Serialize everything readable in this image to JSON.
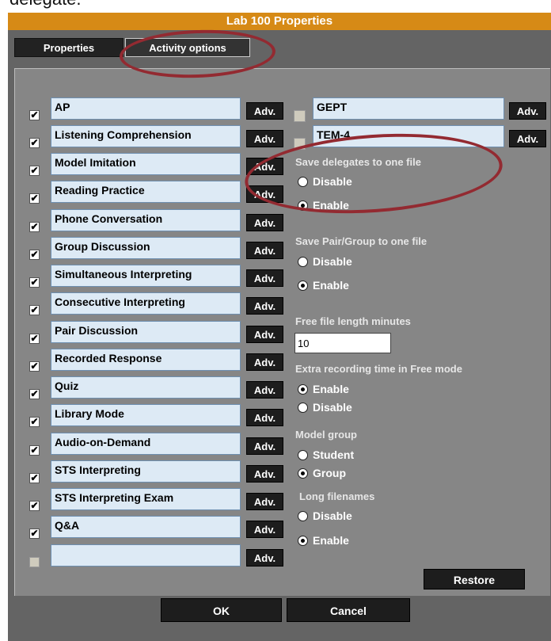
{
  "cropped_caption": "delegate.",
  "window": {
    "title": "Lab 100 Properties"
  },
  "tabs": [
    "Properties",
    "Activity options"
  ],
  "activities_left": [
    {
      "label": "AP",
      "checked": true
    },
    {
      "label": "Listening Comprehension",
      "checked": true
    },
    {
      "label": "Model Imitation",
      "checked": true
    },
    {
      "label": "Reading Practice",
      "checked": true
    },
    {
      "label": "Phone Conversation",
      "checked": true
    },
    {
      "label": "Group Discussion",
      "checked": true
    },
    {
      "label": "Simultaneous Interpreting",
      "checked": true
    },
    {
      "label": "Consecutive Interpreting",
      "checked": true
    },
    {
      "label": "Pair Discussion",
      "checked": true
    },
    {
      "label": "Recorded Response",
      "checked": true
    },
    {
      "label": "Quiz",
      "checked": true
    },
    {
      "label": "Library Mode",
      "checked": true
    },
    {
      "label": "Audio-on-Demand",
      "checked": true
    },
    {
      "label": "STS Interpreting",
      "checked": true
    },
    {
      "label": "STS Interpreting Exam",
      "checked": true
    },
    {
      "label": "Q&A",
      "checked": true
    },
    {
      "label": "",
      "checked": false
    }
  ],
  "activities_right": [
    {
      "label": "GEPT",
      "checked": false
    },
    {
      "label": "TEM-4",
      "checked": false
    }
  ],
  "adv_label": "Adv.",
  "check_mark": "✔",
  "options": {
    "save_delegates": {
      "label": "Save delegates to one file",
      "choices": [
        "Disable",
        "Enable"
      ]
    },
    "save_pair": {
      "label": "Save Pair/Group to one file",
      "choices": [
        "Disable",
        "Enable"
      ]
    },
    "free_length": {
      "label": "Free file length minutes",
      "value": "10"
    },
    "extra_time": {
      "label": "Extra recording time in Free mode",
      "choices": [
        "Enable",
        "Disable"
      ]
    },
    "model_group": {
      "label": "Model group",
      "choices": [
        "Student",
        "Group"
      ]
    },
    "long_filenames": {
      "label": "Long filenames",
      "choices": [
        "Disable",
        "Enable"
      ]
    }
  },
  "buttons": {
    "restore": "Restore",
    "ok": "OK",
    "cancel": "Cancel"
  },
  "colors": {
    "title_bar": "#d68a16",
    "annotation": "#932a31",
    "panel": "#868686",
    "field": "#ddeaf5"
  }
}
